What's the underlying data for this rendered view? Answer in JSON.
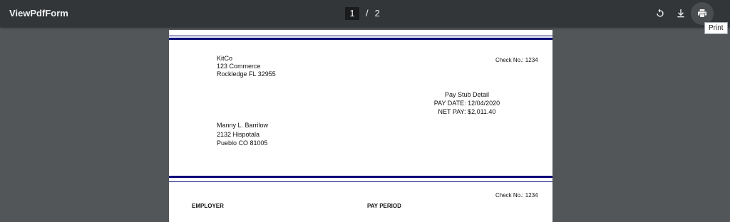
{
  "toolbar": {
    "title": "ViewPdfForm",
    "page_current": "1",
    "page_separator": "/",
    "page_total": "2",
    "icons": [
      "rotate-icon",
      "download-icon",
      "print-icon"
    ],
    "print_tooltip": "Print"
  },
  "page1": {
    "company": {
      "name": "KitCo",
      "address1": "123 Commerce",
      "address2": "Rockledge FL 32955"
    },
    "check_no": "Check No.: 1234",
    "stub_title": "Pay Stub Detail",
    "pay_date": "PAY DATE: 12/04/2020",
    "net_pay": "NET PAY: $2,011.40",
    "employee": {
      "name": "Manny L. Barrilow",
      "address1": "2132 Hispotala",
      "address2": "Pueblo CO 81005"
    }
  },
  "page2": {
    "check_no": "Check No.: 1234",
    "employer_label": "EMPLOYER",
    "pay_period_label": "PAY PERIOD"
  },
  "colors": {
    "toolbar_bg": "#323639",
    "viewer_bg": "#525659",
    "band": "#0a0a78"
  }
}
